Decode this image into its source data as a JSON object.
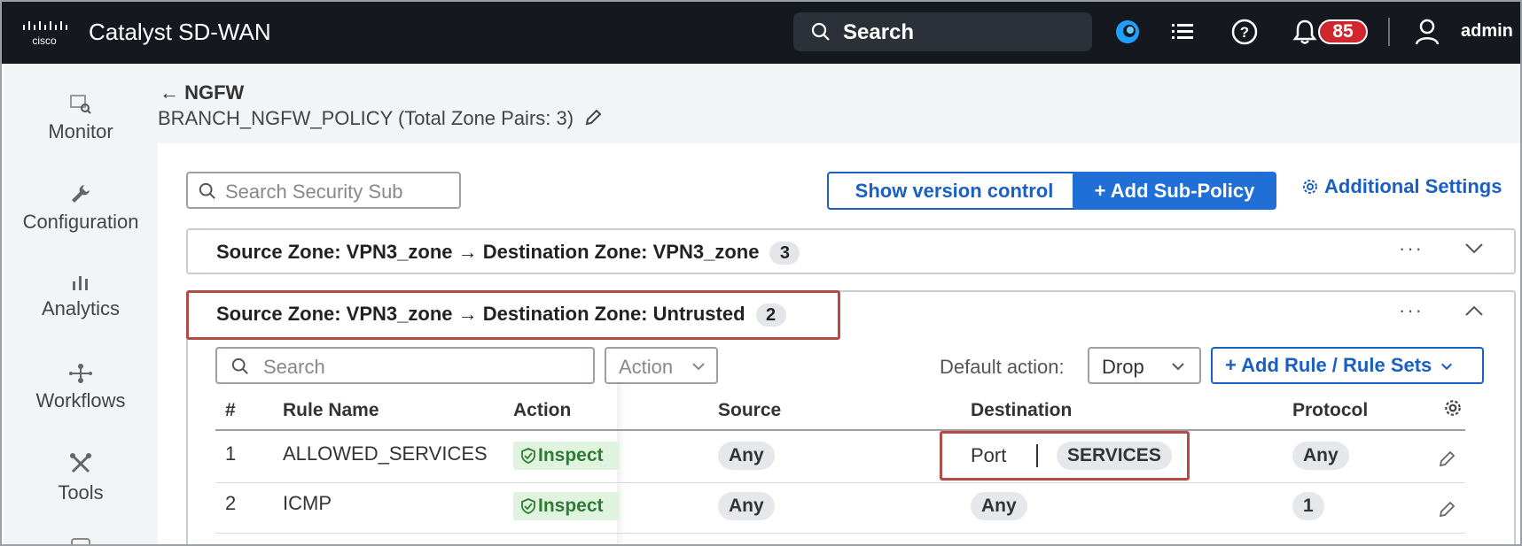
{
  "topbar": {
    "app_title": "Catalyst SD-WAN",
    "search_label": "Search",
    "notification_count": "85",
    "user_name": "admin"
  },
  "leftnav": {
    "items": [
      {
        "label": "Monitor",
        "icon": "monitor-icon"
      },
      {
        "label": "Configuration",
        "icon": "wrench-icon"
      },
      {
        "label": "Analytics",
        "icon": "bar-chart-icon"
      },
      {
        "label": "Workflows",
        "icon": "workflow-icon"
      },
      {
        "label": "Tools",
        "icon": "tools-icon"
      }
    ]
  },
  "header": {
    "back_label": "← NGFW",
    "policy_title": "BRANCH_NGFW_POLICY (Total Zone Pairs: 3)"
  },
  "toolbar": {
    "sub_search_placeholder": "Search Security Sub",
    "show_version_label": "Show version control",
    "add_sub_policy_label": "+ Add Sub-Policy",
    "additional_settings_label": "Additional Settings"
  },
  "zone_pairs": [
    {
      "label": "Source Zone: VPN3_zone  → Destination Zone: VPN3_zone",
      "count": "3"
    },
    {
      "label": "Source Zone: VPN3_zone  → Destination Zone: Untrusted",
      "count": "2"
    }
  ],
  "rules_toolbar": {
    "search_placeholder": "Search",
    "action_label": "Action",
    "default_action_label": "Default action:",
    "default_action_value": "Drop",
    "add_rule_label": "+ Add Rule / Rule Sets"
  },
  "table": {
    "headers": [
      "#",
      "Rule Name",
      "Action",
      "Source",
      "Destination",
      "Protocol"
    ],
    "rows": [
      {
        "num": "1",
        "name": "ALLOWED_SERVICES",
        "action": "Inspect",
        "source": "Any",
        "dest_prefix": "Port",
        "destination": "SERVICES",
        "protocol": "Any"
      },
      {
        "num": "2",
        "name": "ICMP",
        "action": "Inspect",
        "source": "Any",
        "destination": "Any",
        "protocol": "1"
      }
    ]
  },
  "colors": {
    "accent": "#1f6fd6",
    "highlight": "#b64a45",
    "badge": "#d0262d",
    "inspect_bg": "#dff3df",
    "inspect_text": "#2f7a35"
  }
}
